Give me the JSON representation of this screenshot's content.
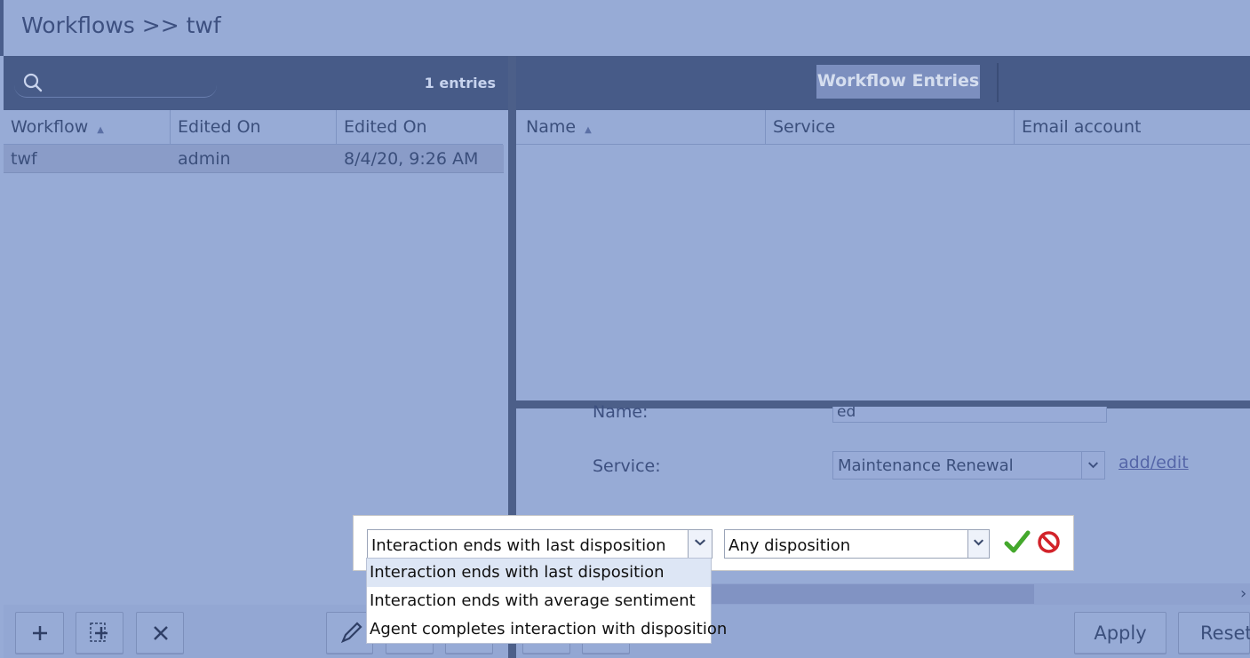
{
  "header": {
    "title": "Workflows >> twf"
  },
  "left_panel": {
    "search": {
      "placeholder": ""
    },
    "entries_count": "1 entries",
    "columns": [
      "Workflow",
      "Edited On",
      "Edited On"
    ],
    "rows": [
      {
        "workflow": "twf",
        "edited_by": "admin",
        "edited_on": "8/4/20, 9:26 AM"
      }
    ]
  },
  "right_panel": {
    "tab": "Workflow Entries",
    "columns": [
      "Name",
      "Service",
      "Email account"
    ]
  },
  "form": {
    "name_label": "Name:",
    "name_value": "ed",
    "service_label": "Service:",
    "service_value": "Maintenance Renewal",
    "add_edit_link": "add/edit"
  },
  "popup": {
    "condition_value": "Interaction ends with last disposition",
    "disposition_value": "Any disposition",
    "options": [
      "Interaction ends with last disposition",
      "Interaction ends with average sentiment",
      "Agent completes interaction with disposition"
    ]
  },
  "bottom": {
    "apply_label": "Apply",
    "reset_label": "Reset"
  },
  "colors": {
    "toolbar": "#475b88",
    "background": "#97abd6",
    "divider": "#4c5f89",
    "confirm": "#44a82c",
    "cancel": "#d2232a"
  }
}
